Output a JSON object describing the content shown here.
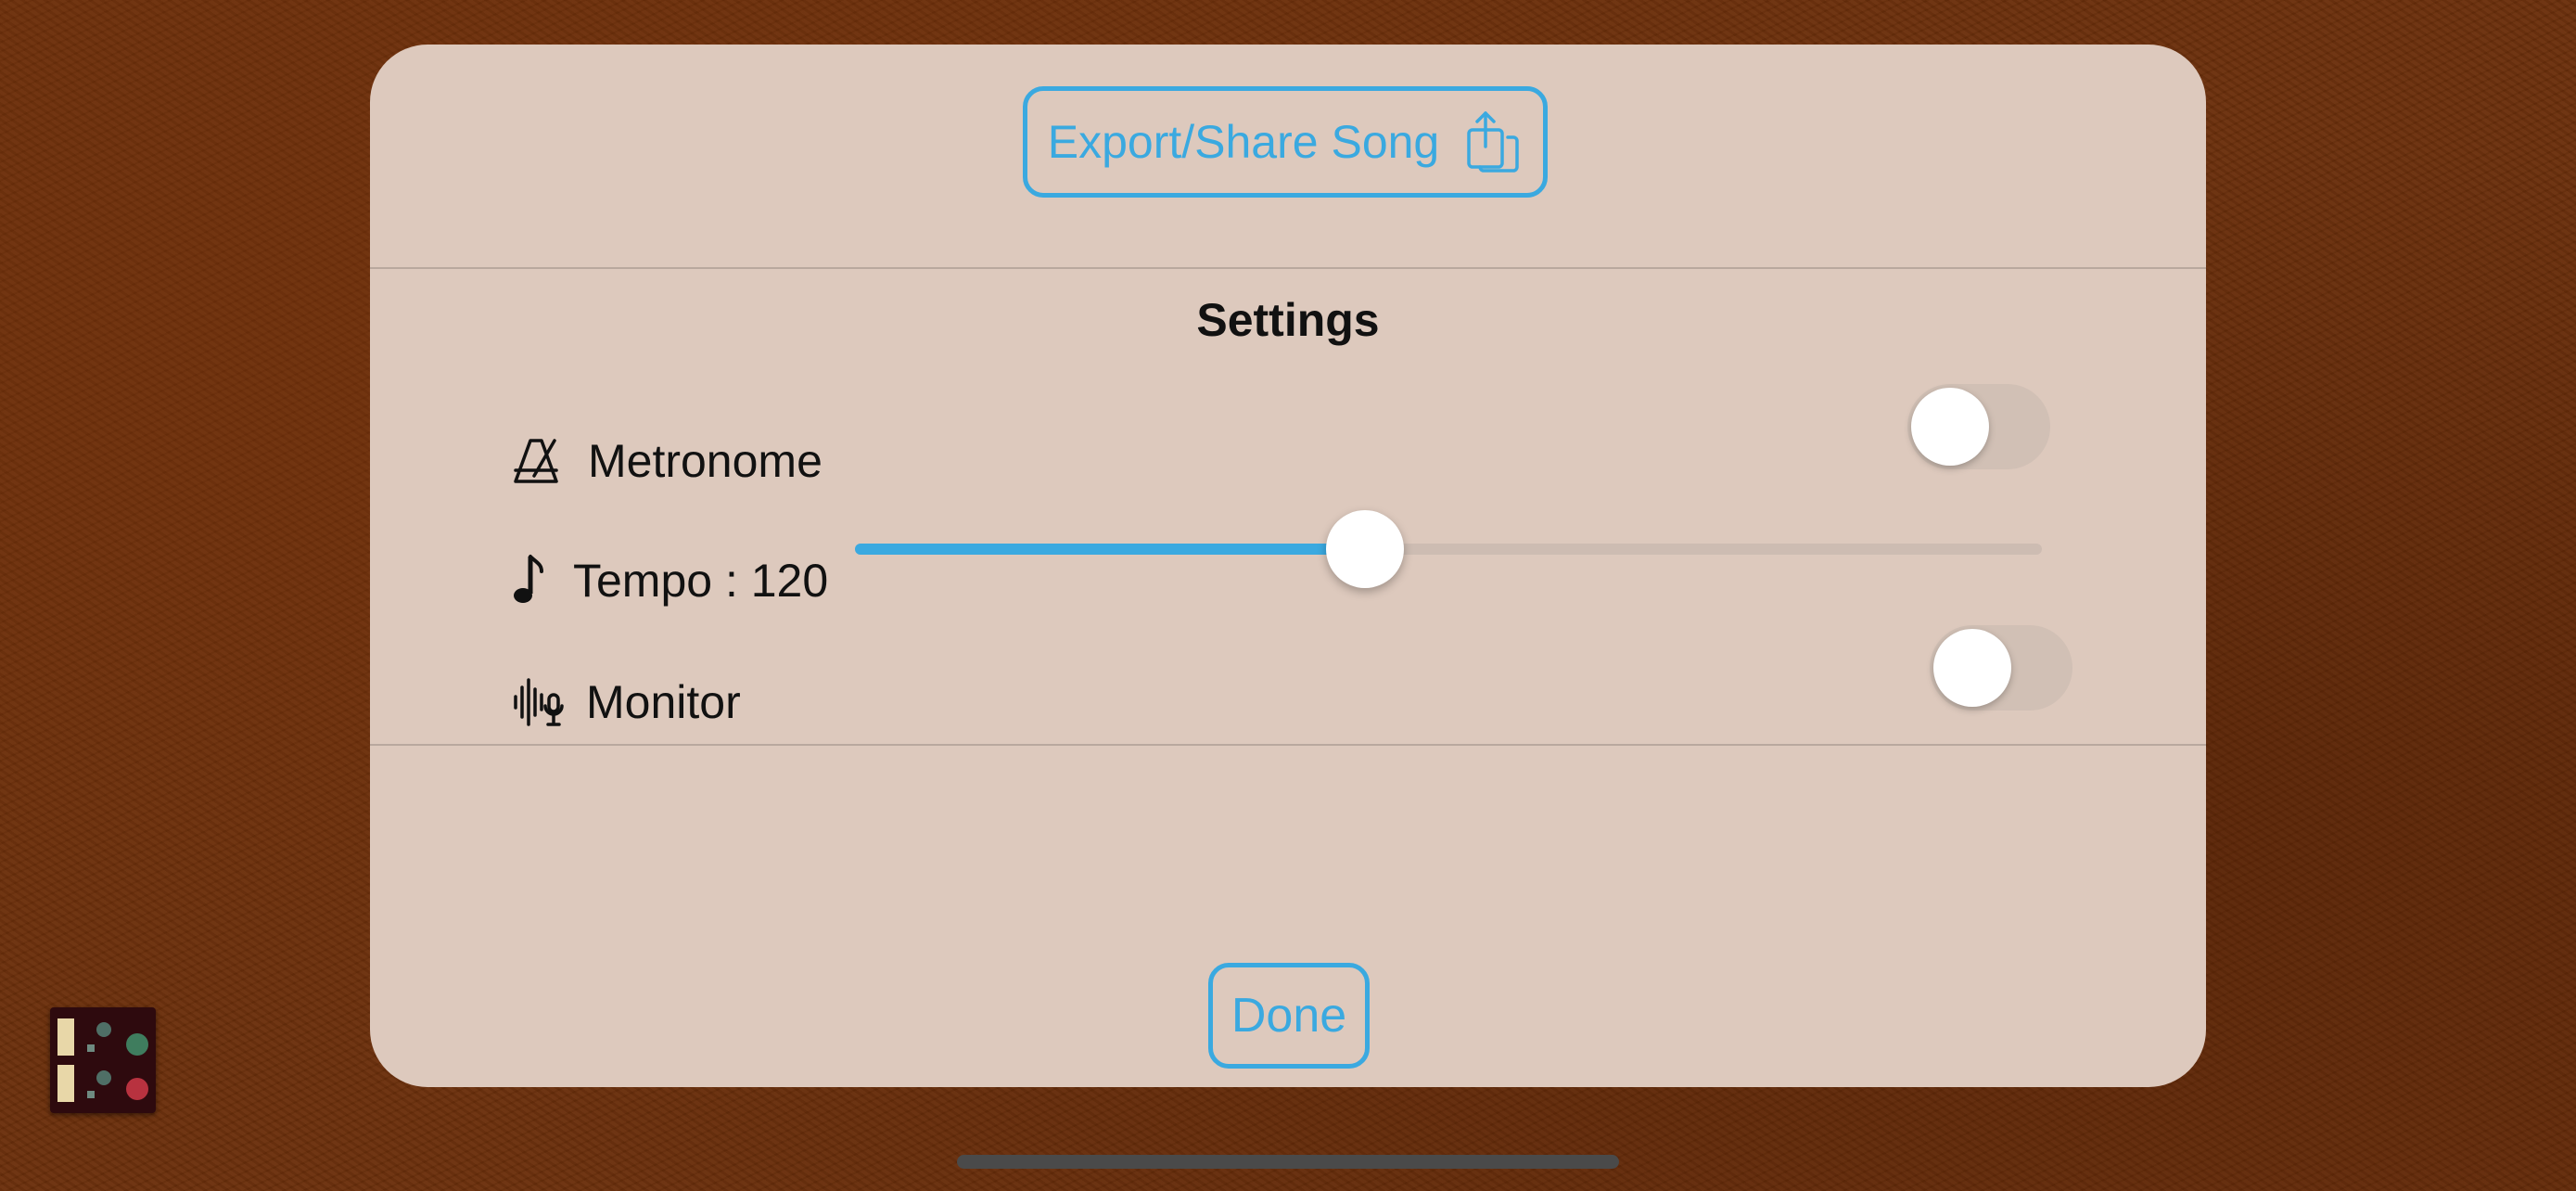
{
  "sheet": {
    "export_button_label": "Export/Share Song",
    "export_icon": "share-icon",
    "settings_title": "Settings",
    "metronome": {
      "label": "Metronome",
      "icon": "metronome-icon",
      "enabled": false
    },
    "tempo": {
      "label": "Tempo : 120",
      "icon": "music-note-icon",
      "value": 120,
      "slider_fraction": 0.43
    },
    "monitor": {
      "label": "Monitor",
      "icon": "waveform-mic-icon",
      "enabled": false
    },
    "done_button_label": "Done"
  },
  "colors": {
    "accent": "#3aa9e0",
    "sheet_background": "#ddc9bd",
    "leather_background": "#6b2f0b"
  }
}
